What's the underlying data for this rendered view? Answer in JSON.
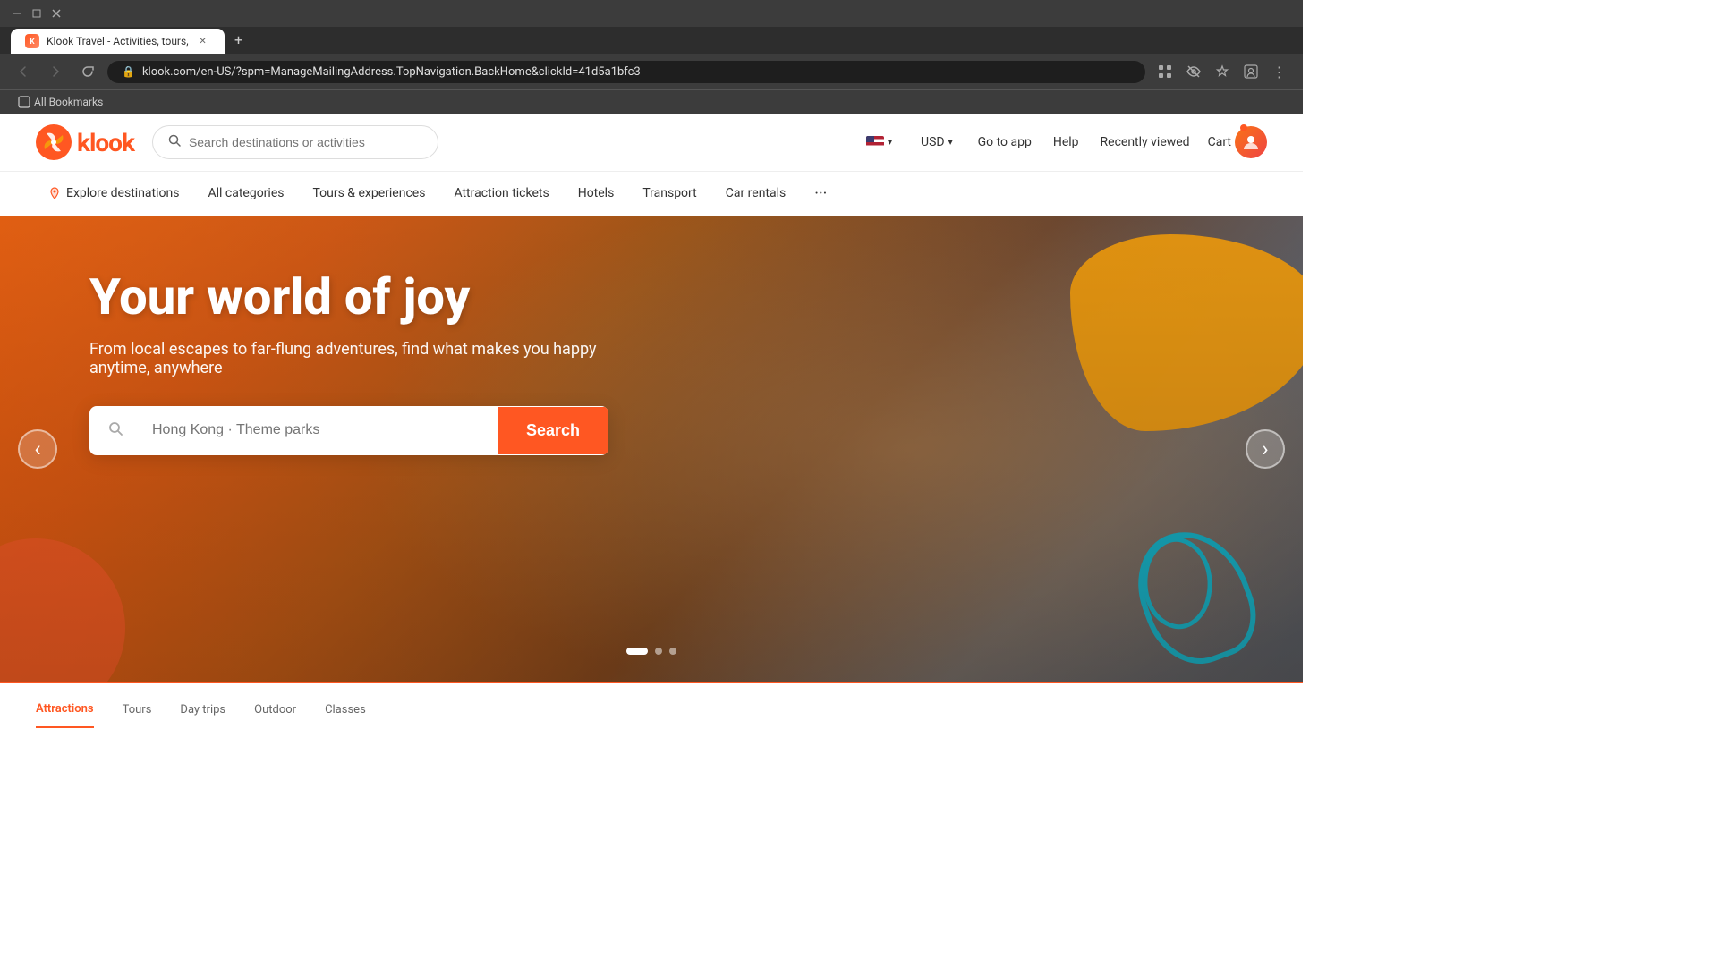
{
  "browser": {
    "tab_title": "Klook Travel - Activities, tours,",
    "url": "klook.com/en-US/?spm=ManageMailingAddress.TopNavigation.BackHome&clickId=41d5a1bfc3",
    "bookmarks_label": "All Bookmarks",
    "new_tab_label": "+"
  },
  "nav": {
    "logo_text": "klook",
    "search_placeholder": "Search destinations or activities",
    "lang": "USD",
    "currency": "USD",
    "go_to_app": "Go to app",
    "help": "Help",
    "recently_viewed": "Recently viewed",
    "cart": "Cart",
    "currency_symbol": "USD"
  },
  "secondary_nav": {
    "items": [
      {
        "label": "Explore destinations",
        "icon": "location",
        "active": false
      },
      {
        "label": "All categories",
        "active": false
      },
      {
        "label": "Tours & experiences",
        "active": false
      },
      {
        "label": "Attraction tickets",
        "active": false
      },
      {
        "label": "Hotels",
        "active": false
      },
      {
        "label": "Transport",
        "active": false
      },
      {
        "label": "Car rentals",
        "active": false
      },
      {
        "label": "...",
        "active": false
      }
    ]
  },
  "hero": {
    "title": "Your world of joy",
    "subtitle": "From local escapes to far-flung adventures, find what makes you happy anytime, anywhere",
    "search_placeholder": "Hong Kong · Theme parks",
    "search_button_label": "Search",
    "prev_arrow": "‹",
    "next_arrow": "›"
  }
}
